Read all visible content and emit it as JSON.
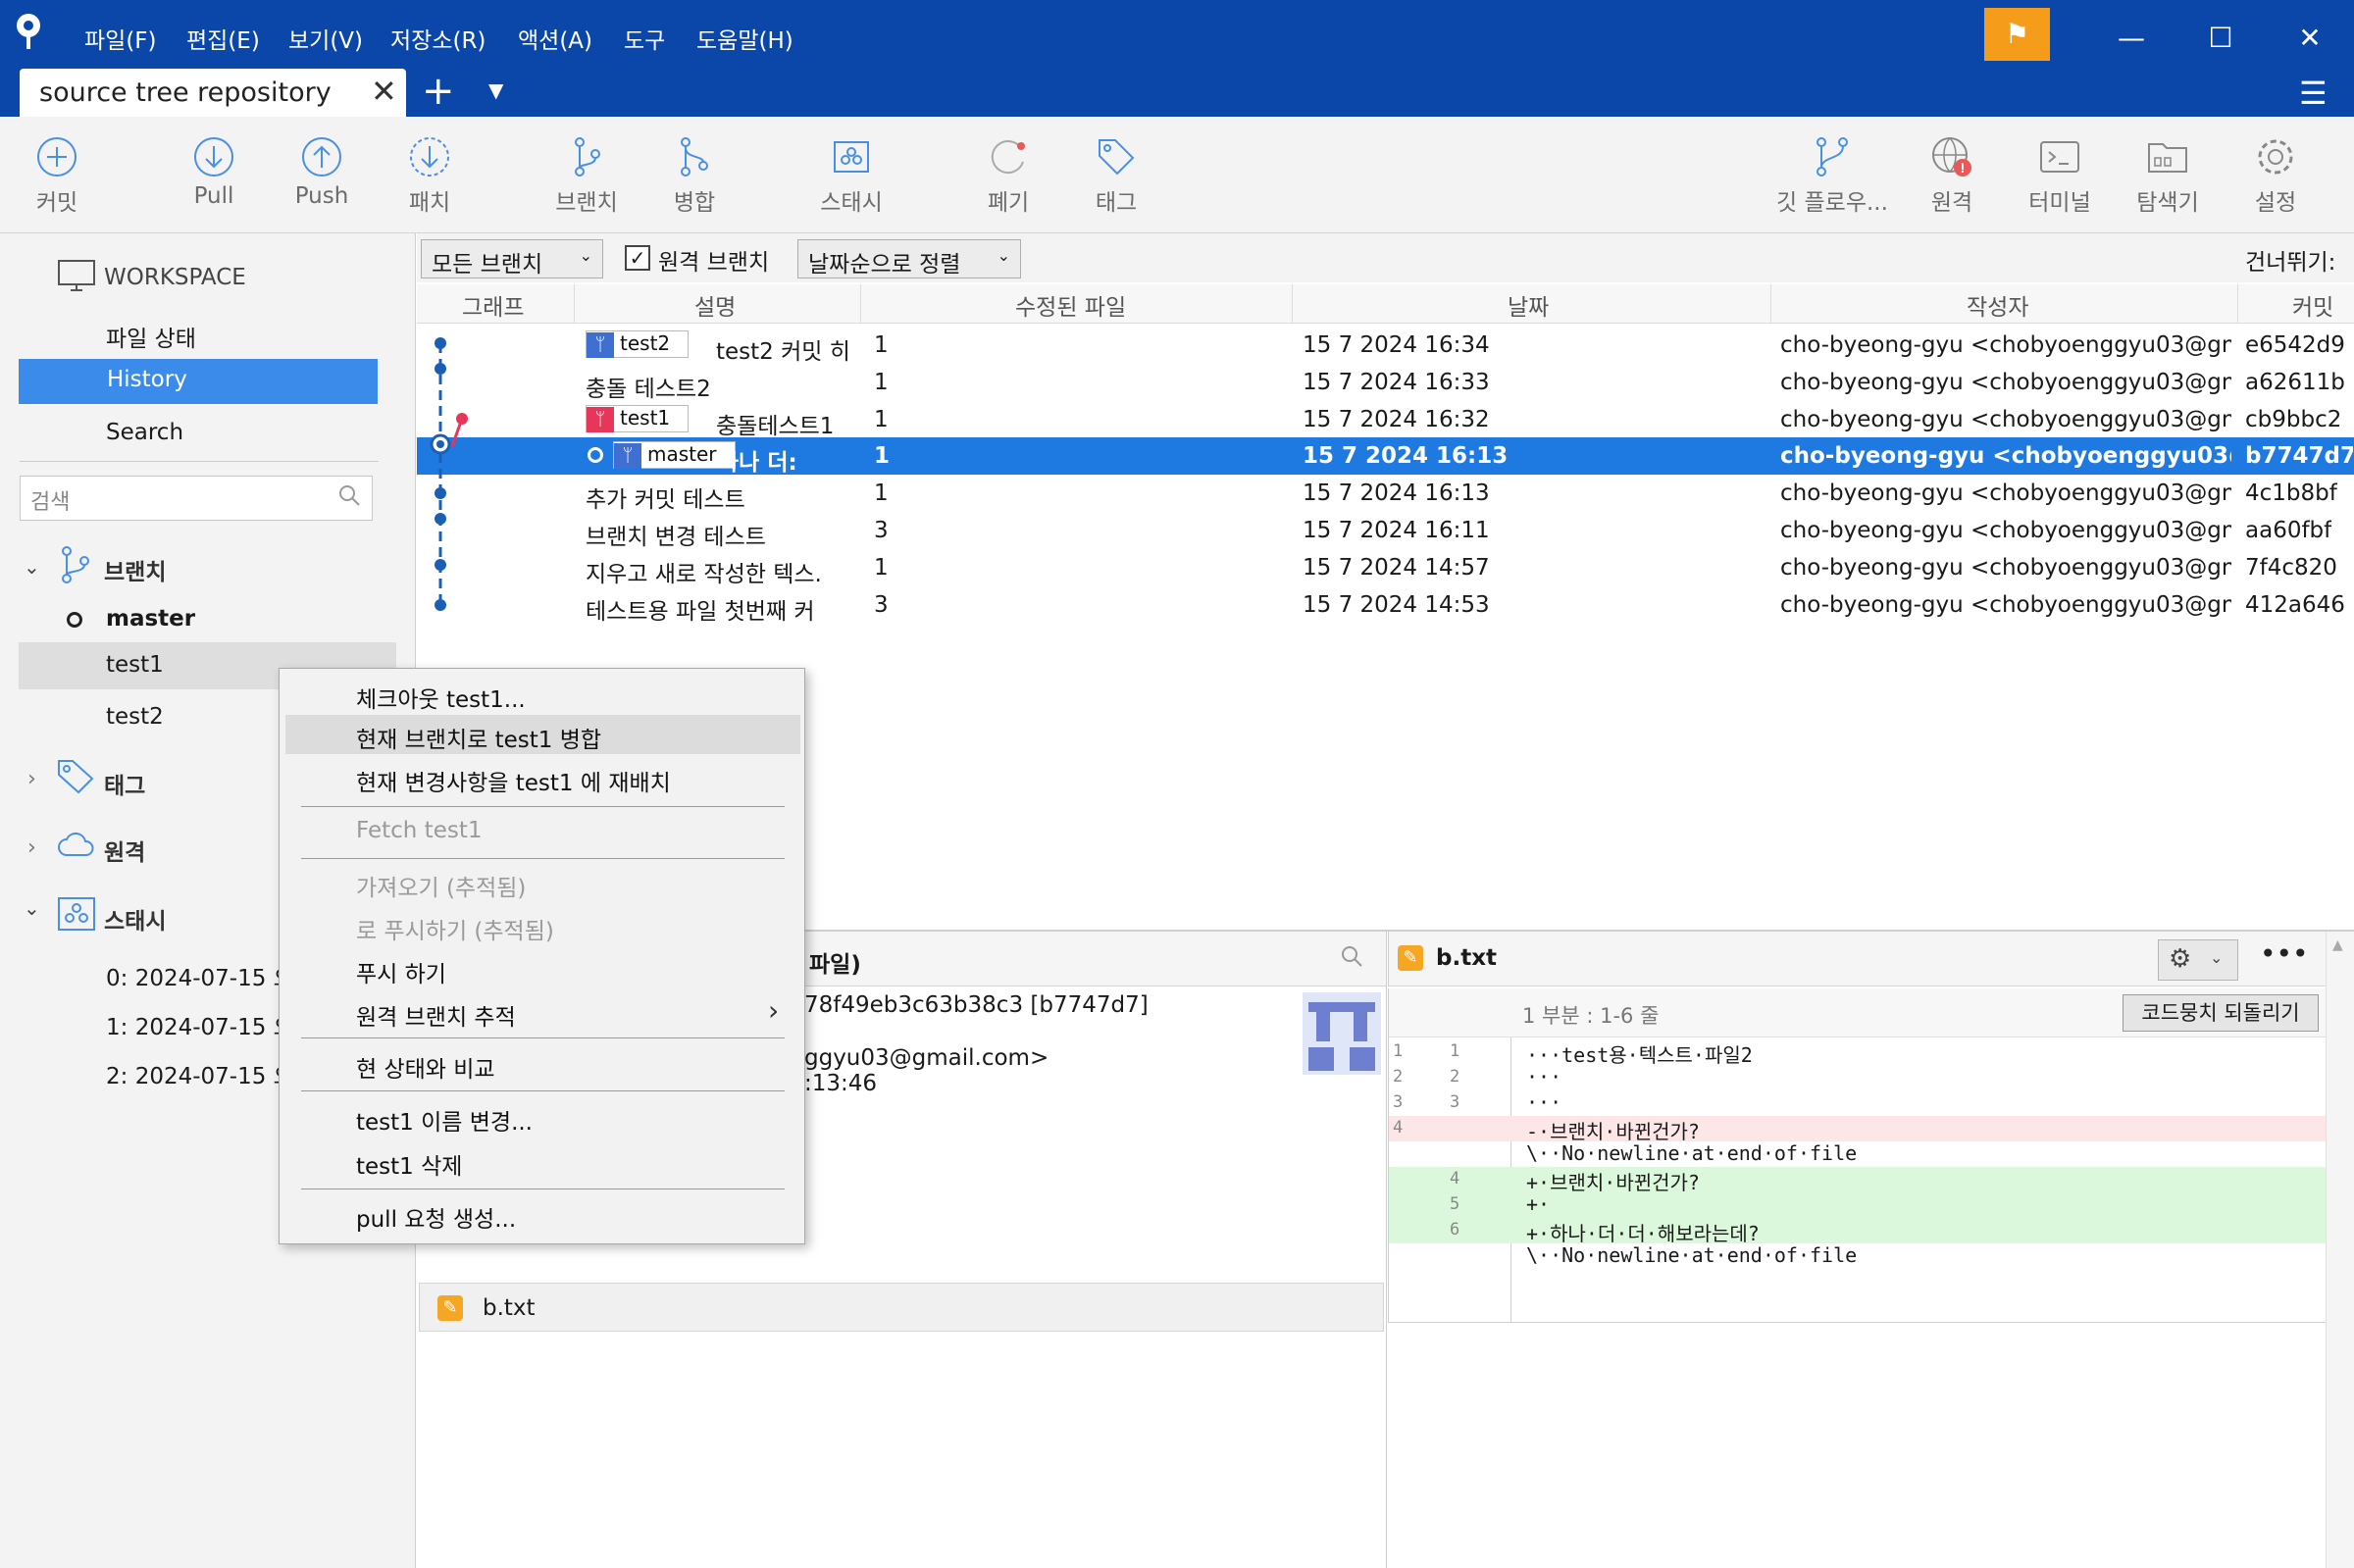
{
  "menu": [
    "파일(F)",
    "편집(E)",
    "보기(V)",
    "저장소(R)",
    "액션(A)",
    "도구",
    "도움말(H)"
  ],
  "tab": {
    "title": "source tree repository"
  },
  "toolbar": {
    "commit": "커밋",
    "pull": "Pull",
    "push": "Push",
    "fetch": "패치",
    "branch": "브랜치",
    "merge": "병합",
    "stash": "스태시",
    "discard": "폐기",
    "tag": "태그",
    "gitflow": "깃 플로우...",
    "remote": "원격",
    "terminal": "터미널",
    "explorer": "탐색기",
    "settings": "설정"
  },
  "sidebar": {
    "workspace": "WORKSPACE",
    "file_status": "파일 상태",
    "history": "History",
    "search": "Search",
    "search_placeholder": "검색",
    "branches_label": "브랜치",
    "branches": [
      "master",
      "test1",
      "test2"
    ],
    "tags_label": "태그",
    "remotes_label": "원격",
    "stash_label": "스태시",
    "stashes": [
      "0: 2024-07-15 오",
      "1: 2024-07-15 오",
      "2: 2024-07-15 오"
    ]
  },
  "filter": {
    "all_branches": "모든 브랜치",
    "remote_branches": "원격 브랜치",
    "remote_checked": true,
    "sort": "날짜순으로 정렬",
    "jump": "건너뛰기:"
  },
  "columns": [
    "그래프",
    "설명",
    "수정된 파일",
    "날짜",
    "작성자",
    "커밋"
  ],
  "commits": [
    {
      "tag": "test2",
      "desc": "test2 커밋 히",
      "files": "1",
      "date": "15 7 2024 16:34",
      "author": "cho-byeong-gyu <chobyoenggyu03@gm",
      "hash": "e6542d9"
    },
    {
      "tag": "",
      "desc": "충돌 테스트2",
      "files": "1",
      "date": "15 7 2024 16:33",
      "author": "cho-byeong-gyu <chobyoenggyu03@gm",
      "hash": "a62611b"
    },
    {
      "tag": "test1",
      "desc": "충돌테스트1",
      "files": "1",
      "date": "15 7 2024 16:32",
      "author": "cho-byeong-gyu <chobyoenggyu03@gm",
      "hash": "cb9bbc2"
    },
    {
      "tag": "master",
      "desc": "하나 더:",
      "files": "1",
      "date": "15 7 2024 16:13",
      "author": "cho-byeong-gyu <chobyoenggyu03@gı",
      "hash": "b7747d7"
    },
    {
      "tag": "",
      "desc": "추가 커밋 테스트",
      "files": "1",
      "date": "15 7 2024 16:13",
      "author": "cho-byeong-gyu <chobyoenggyu03@gm",
      "hash": "4c1b8bf"
    },
    {
      "tag": "",
      "desc": "브랜치 변경 테스트",
      "files": "3",
      "date": "15 7 2024 16:11",
      "author": "cho-byeong-gyu <chobyoenggyu03@gm",
      "hash": "aa60fbf"
    },
    {
      "tag": "",
      "desc": "지우고 새로 작성한 텍스.",
      "files": "1",
      "date": "15 7 2024 14:57",
      "author": "cho-byeong-gyu <chobyoenggyu03@gm",
      "hash": "7f4c820"
    },
    {
      "tag": "",
      "desc": "테스트용 파일 첫번째 커",
      "files": "3",
      "date": "15 7 2024 14:53",
      "author": "cho-byeong-gyu <chobyoenggyu03@gm",
      "hash": "412a646"
    }
  ],
  "details": {
    "head_fragment": "파일)",
    "hash_fragment": "78f49eb3c63b38c3 [b7747d7]",
    "email_fragment": "ggyu03@gmail.com>",
    "time_fragment": ":13:46",
    "file": "b.txt"
  },
  "diff": {
    "file": "b.txt",
    "hunk": "1 부분 : 1-6 줄",
    "reset_btn": "코드뭉치 되돌리기",
    "lines": [
      {
        "old": "1",
        "new": "1",
        "kind": "ctx",
        "text": "···test용·텍스트·파일2"
      },
      {
        "old": "2",
        "new": "2",
        "kind": "ctx",
        "text": "···"
      },
      {
        "old": "3",
        "new": "3",
        "kind": "ctx",
        "text": "···"
      },
      {
        "old": "4",
        "new": "",
        "kind": "rem",
        "text": "-·브랜치·바뀐건가?"
      },
      {
        "old": "",
        "new": "",
        "kind": "ctx",
        "text": "\\··No·newline·at·end·of·file"
      },
      {
        "old": "",
        "new": "4",
        "kind": "add",
        "text": "+·브랜치·바뀐건가?"
      },
      {
        "old": "",
        "new": "5",
        "kind": "add",
        "text": "+·"
      },
      {
        "old": "",
        "new": "6",
        "kind": "add",
        "text": "+·하나·더·더·해보라는데?"
      },
      {
        "old": "",
        "new": "",
        "kind": "ctx",
        "text": "\\··No·newline·at·end·of·file"
      }
    ]
  },
  "context_menu": {
    "checkout": "체크아웃 test1...",
    "merge": "현재 브랜치로 test1 병합",
    "rebase": "현재 변경사항을 test1 에 재배치",
    "fetch": "Fetch test1",
    "pull_tracked": "가져오기  (추적됨)",
    "push_tracked": "로 푸시하기 (추적됨)",
    "push": "푸시 하기",
    "track_remote": "원격 브랜치 추적",
    "compare": "현 상태와 비교",
    "rename": "test1 이름 변경...",
    "delete": "test1 삭제",
    "pull_request": "pull 요청 생성..."
  }
}
